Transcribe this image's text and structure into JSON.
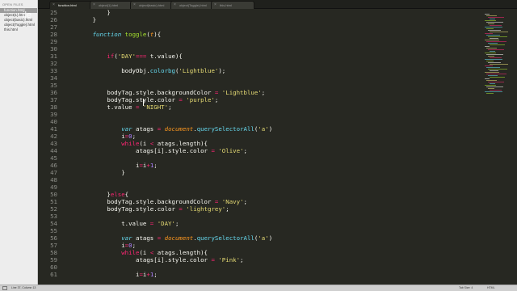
{
  "sidebar": {
    "heading": "OPEN FILES",
    "items": [
      "function.html",
      "object(1).html",
      "object(basic).html",
      "object(Toggle).html",
      "this.html"
    ],
    "active_index": 0
  },
  "watermark": "ile",
  "tabs": [
    {
      "label": "function.html",
      "active": true
    },
    {
      "label": "object(1).html",
      "active": false
    },
    {
      "label": "object(basic).html",
      "active": false
    },
    {
      "label": "object(Toggle).html",
      "active": false
    },
    {
      "label": "this.html",
      "active": false
    }
  ],
  "editor": {
    "line_start": 25,
    "lines": [
      [
        {
          "t": "            }",
          "c": "p"
        }
      ],
      [
        {
          "t": "        }",
          "c": "p"
        }
      ],
      [],
      [
        {
          "t": "        ",
          "c": "p"
        },
        {
          "t": "function",
          "c": "sf"
        },
        {
          "t": " ",
          "c": "p"
        },
        {
          "t": "toggle",
          "c": "g"
        },
        {
          "t": "(",
          "c": "p"
        },
        {
          "t": "t",
          "c": "oi"
        },
        {
          "t": "){",
          "c": "p"
        }
      ],
      [],
      [],
      [
        {
          "t": "            ",
          "c": "p"
        },
        {
          "t": "if",
          "c": "k"
        },
        {
          "t": "(",
          "c": "p"
        },
        {
          "t": "'DAY'",
          "c": "y"
        },
        {
          "t": "=== ",
          "c": "k"
        },
        {
          "t": "t.value){",
          "c": "p"
        }
      ],
      [],
      [
        {
          "t": "                bodyObj.",
          "c": "p"
        },
        {
          "t": "colorbg",
          "c": "b"
        },
        {
          "t": "(",
          "c": "p"
        },
        {
          "t": "'Lightblue'",
          "c": "y"
        },
        {
          "t": ");",
          "c": "p"
        }
      ],
      [],
      [],
      [
        {
          "t": "            bodyTag.style.backgroundColor ",
          "c": "p"
        },
        {
          "t": "=",
          "c": "k"
        },
        {
          "t": " ",
          "c": "p"
        },
        {
          "t": "'Lightblue'",
          "c": "y"
        },
        {
          "t": ";",
          "c": "p"
        }
      ],
      [
        {
          "t": "            bodyTag.style.color ",
          "c": "p"
        },
        {
          "t": "=",
          "c": "k"
        },
        {
          "t": " ",
          "c": "p"
        },
        {
          "t": "'purple'",
          "c": "y"
        },
        {
          "t": ";",
          "c": "p"
        }
      ],
      [
        {
          "t": "            t.value ",
          "c": "p"
        },
        {
          "t": "=",
          "c": "k"
        },
        {
          "t": " ",
          "c": "p"
        },
        {
          "t": "'NIGHT'",
          "c": "y"
        },
        {
          "t": ";",
          "c": "p"
        }
      ],
      [],
      [],
      [
        {
          "t": "                ",
          "c": "p"
        },
        {
          "t": "var",
          "c": "sf"
        },
        {
          "t": " atags ",
          "c": "p"
        },
        {
          "t": "=",
          "c": "k"
        },
        {
          "t": " ",
          "c": "p"
        },
        {
          "t": "document",
          "c": "oi"
        },
        {
          "t": ".",
          "c": "p"
        },
        {
          "t": "querySelectorAll",
          "c": "b"
        },
        {
          "t": "(",
          "c": "p"
        },
        {
          "t": "'a'",
          "c": "y"
        },
        {
          "t": ")",
          "c": "p"
        }
      ],
      [
        {
          "t": "                i",
          "c": "p"
        },
        {
          "t": "=",
          "c": "k"
        },
        {
          "t": "0",
          "c": "m"
        },
        {
          "t": ";",
          "c": "p"
        }
      ],
      [
        {
          "t": "                ",
          "c": "p"
        },
        {
          "t": "while",
          "c": "k"
        },
        {
          "t": "(i ",
          "c": "p"
        },
        {
          "t": "<",
          "c": "k"
        },
        {
          "t": " atags.length){",
          "c": "p"
        }
      ],
      [
        {
          "t": "                    atags[i].style.color ",
          "c": "p"
        },
        {
          "t": "=",
          "c": "k"
        },
        {
          "t": " ",
          "c": "p"
        },
        {
          "t": "'Olive'",
          "c": "y"
        },
        {
          "t": ";",
          "c": "p"
        }
      ],
      [],
      [
        {
          "t": "                    i",
          "c": "p"
        },
        {
          "t": "=",
          "c": "k"
        },
        {
          "t": "i",
          "c": "p"
        },
        {
          "t": "+",
          "c": "k"
        },
        {
          "t": "1",
          "c": "m"
        },
        {
          "t": ";",
          "c": "p"
        }
      ],
      [
        {
          "t": "                }",
          "c": "p"
        }
      ],
      [],
      [],
      [
        {
          "t": "            }",
          "c": "p"
        },
        {
          "t": "else",
          "c": "k"
        },
        {
          "t": "{",
          "c": "p"
        }
      ],
      [
        {
          "t": "            bodyTag.style.backgroundColor ",
          "c": "p"
        },
        {
          "t": "=",
          "c": "k"
        },
        {
          "t": " ",
          "c": "p"
        },
        {
          "t": "'Navy'",
          "c": "y"
        },
        {
          "t": ";",
          "c": "p"
        }
      ],
      [
        {
          "t": "            bodyTag.style.color ",
          "c": "p"
        },
        {
          "t": "=",
          "c": "k"
        },
        {
          "t": " ",
          "c": "p"
        },
        {
          "t": "'lightgrey'",
          "c": "y"
        },
        {
          "t": ";",
          "c": "p"
        }
      ],
      [],
      [
        {
          "t": "                t.value ",
          "c": "p"
        },
        {
          "t": "=",
          "c": "k"
        },
        {
          "t": " ",
          "c": "p"
        },
        {
          "t": "'DAY'",
          "c": "y"
        },
        {
          "t": ";",
          "c": "p"
        }
      ],
      [],
      [
        {
          "t": "                ",
          "c": "p"
        },
        {
          "t": "var",
          "c": "sf"
        },
        {
          "t": " atags ",
          "c": "p"
        },
        {
          "t": "=",
          "c": "k"
        },
        {
          "t": " ",
          "c": "p"
        },
        {
          "t": "document",
          "c": "oi"
        },
        {
          "t": ".",
          "c": "p"
        },
        {
          "t": "querySelectorAll",
          "c": "b"
        },
        {
          "t": "(",
          "c": "p"
        },
        {
          "t": "'a'",
          "c": "y"
        },
        {
          "t": ")",
          "c": "p"
        }
      ],
      [
        {
          "t": "                i",
          "c": "p"
        },
        {
          "t": "=",
          "c": "k"
        },
        {
          "t": "0",
          "c": "m"
        },
        {
          "t": ";",
          "c": "p"
        }
      ],
      [
        {
          "t": "                ",
          "c": "p"
        },
        {
          "t": "while",
          "c": "k"
        },
        {
          "t": "(i ",
          "c": "p"
        },
        {
          "t": "<",
          "c": "k"
        },
        {
          "t": " atags.length){",
          "c": "p"
        }
      ],
      [
        {
          "t": "                    atags[i].style.color ",
          "c": "p"
        },
        {
          "t": "=",
          "c": "k"
        },
        {
          "t": " ",
          "c": "p"
        },
        {
          "t": "'Pink'",
          "c": "y"
        },
        {
          "t": ";",
          "c": "p"
        }
      ],
      [],
      [
        {
          "t": "                    i",
          "c": "p"
        },
        {
          "t": "=",
          "c": "k"
        },
        {
          "t": "i",
          "c": "p"
        },
        {
          "t": "+",
          "c": "k"
        },
        {
          "t": "1",
          "c": "m"
        },
        {
          "t": ";",
          "c": "p"
        }
      ]
    ]
  },
  "syntax_colors": {
    "p": "#f8f8f2",
    "k": "#f92672",
    "y": "#e6db74",
    "b": "#66d9ef",
    "g": "#a6e22e",
    "m": "#ae81ff",
    "sf": "#66d9ef",
    "oi": "#fd971f"
  },
  "statusbar": {
    "left": "Line 37, Column 13",
    "right1": "Tab Size: 4",
    "right2": "HTML"
  }
}
